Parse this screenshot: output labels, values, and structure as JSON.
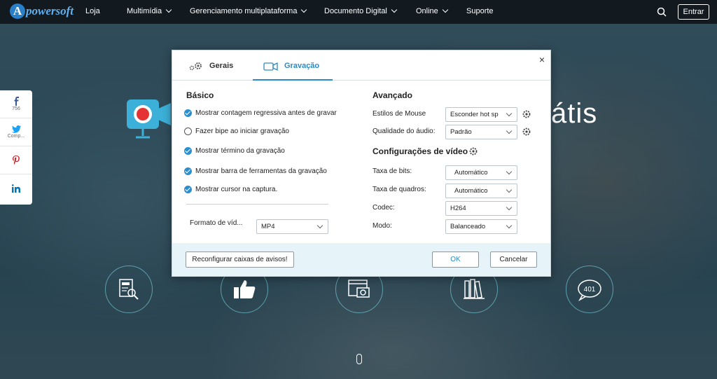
{
  "nav": {
    "logo_letter": "A",
    "logo_text": "powersoft",
    "items": [
      {
        "label": "Loja",
        "dropdown": false
      },
      {
        "label": "Multimídia",
        "dropdown": true
      },
      {
        "label": "Gerenciamento multiplataforma",
        "dropdown": true
      },
      {
        "label": "Documento Digital",
        "dropdown": true
      },
      {
        "label": "Online",
        "dropdown": true
      },
      {
        "label": "Suporte",
        "dropdown": false
      }
    ],
    "login_label": "Entrar"
  },
  "social": {
    "facebook_count": "756",
    "twitter_label": "Comp..."
  },
  "hero": {
    "text": "átis"
  },
  "dialog": {
    "close": "×",
    "tabs": [
      {
        "label": "Gerais",
        "active": false
      },
      {
        "label": "Gravação",
        "active": true
      }
    ],
    "basic": {
      "title": "Básico",
      "options": [
        {
          "label": "Mostrar contagem regressiva antes de gravar",
          "checked": true
        },
        {
          "label": "Fazer bipe ao iniciar gravação",
          "checked": false
        },
        {
          "label": "Mostrar término da gravação",
          "checked": true
        },
        {
          "label": "Mostrar barra de ferramentas da gravação",
          "checked": true
        },
        {
          "label": "Mostrar cursor na captura.",
          "checked": true
        }
      ],
      "format_label": "Formato de víd...",
      "format_value": "MP4"
    },
    "advanced": {
      "title": "Avançado",
      "mouse_style_label": "Estilos de Mouse",
      "mouse_style_value": "Esconder hot sp",
      "audio_quality_label": "Qualidade do áudio:",
      "audio_quality_value": "Padrão",
      "video_settings_title": "Configurações de vídeo",
      "bitrate_label": "Taxa de bits:",
      "bitrate_value": "Automático",
      "framerate_label": "Taxa de quadros:",
      "framerate_value": "Automático",
      "codec_label": "Codec:",
      "codec_value": "H264",
      "mode_label": "Modo:",
      "mode_value": "Balanceado"
    },
    "footer": {
      "reset_label": "Reconfigurar caixas de avisos!",
      "ok_label": "OK",
      "cancel_label": "Cancelar"
    }
  },
  "bottom_icons": {
    "badge_number": "401"
  },
  "colors": {
    "nav_bg": "#121a20",
    "accent": "#2d8ac2",
    "footer_bg": "#e6f3f8",
    "recorder_blue": "#3cb0d8",
    "recorder_red": "#e53333"
  }
}
